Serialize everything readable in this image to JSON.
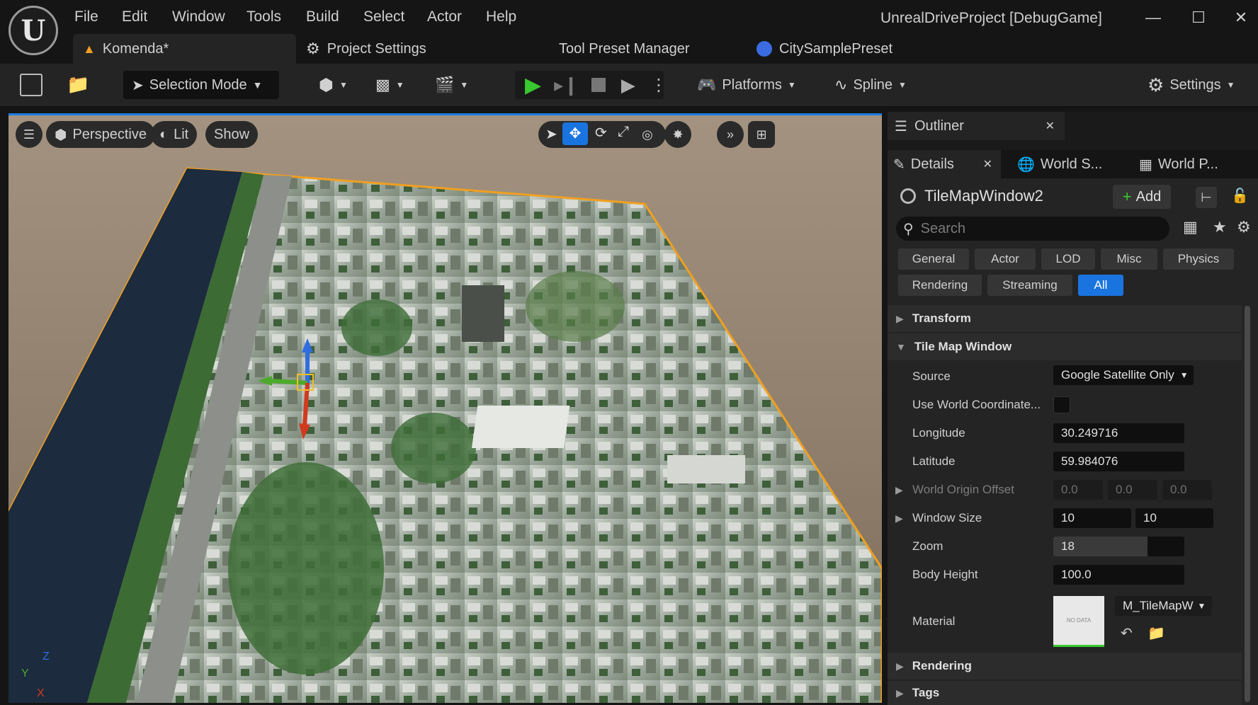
{
  "menu": [
    "File",
    "Edit",
    "Window",
    "Tools",
    "Build",
    "Select",
    "Actor",
    "Help"
  ],
  "window_title": "UnrealDriveProject [DebugGame]",
  "tabs": [
    {
      "label": "Komenda*"
    },
    {
      "label": "Project Settings"
    },
    {
      "label": "Tool Preset Manager"
    },
    {
      "label": "CitySamplePreset"
    }
  ],
  "toolbar": {
    "selection_mode": "Selection Mode",
    "platforms": "Platforms",
    "spline": "Spline",
    "settings": "Settings"
  },
  "viewport": {
    "perspective": "Perspective",
    "lit": "Lit",
    "show": "Show",
    "axis_z": "Z",
    "axis_y": "Y",
    "axis_x": "X"
  },
  "panels": {
    "outliner": "Outliner",
    "details": "Details",
    "world_settings": "World S...",
    "world_partition": "World P..."
  },
  "details": {
    "actor_name": "TileMapWindow2",
    "add_label": "Add",
    "search_placeholder": "Search",
    "filters_row1": [
      "General",
      "Actor",
      "LOD",
      "Misc",
      "Physics"
    ],
    "filters_row2": [
      "Rendering",
      "Streaming",
      "All"
    ],
    "sections": {
      "transform": "Transform",
      "tile_map_window": "Tile Map Window",
      "rendering": "Rendering",
      "tags": "Tags"
    },
    "props": {
      "source_label": "Source",
      "source_value": "Google Satellite Only",
      "use_world_label": "Use World Coordinate...",
      "longitude_label": "Longitude",
      "longitude_value": "30.249716",
      "latitude_label": "Latitude",
      "latitude_value": "59.984076",
      "world_origin_label": "World Origin Offset",
      "world_origin_x": "0.0",
      "world_origin_y": "0.0",
      "world_origin_z": "0.0",
      "window_size_label": "Window Size",
      "window_size_x": "10",
      "window_size_y": "10",
      "zoom_label": "Zoom",
      "zoom_value": "18",
      "body_height_label": "Body Height",
      "body_height_value": "100.0",
      "material_label": "Material",
      "material_value": "M_TileMapW",
      "material_thumb_text": "NO DATA"
    }
  },
  "colors": {
    "accent": "#1a74e0",
    "play_green": "#37c92f",
    "selection_orange": "#f0a020"
  }
}
